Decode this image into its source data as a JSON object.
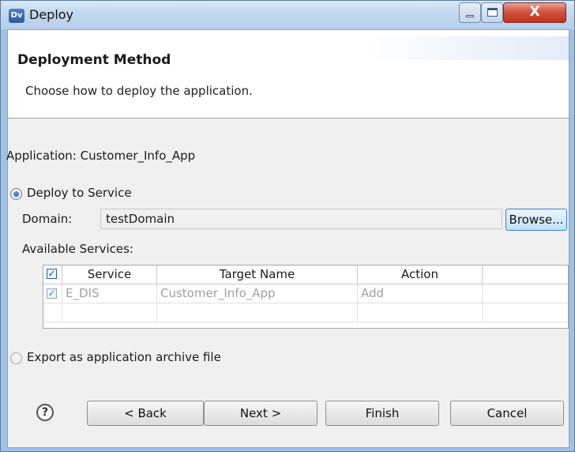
{
  "window": {
    "title": "Deploy",
    "icon_label": "Dv",
    "icon_name": "app-icon",
    "controls": {
      "minimize": "minimize-icon",
      "maximize": "maximize-icon",
      "close_glyph": "X"
    }
  },
  "banner": {
    "title": "Deployment Method",
    "description": "Choose how to deploy the application."
  },
  "application_label": "Application: Customer_Info_App",
  "deploy_to_service": {
    "label": "Deploy to Service",
    "selected": true,
    "domain_label": "Domain:",
    "domain_value": "testDomain",
    "browse_label": "Browse...",
    "services_label": "Available Services:",
    "table": {
      "headers": [
        "",
        "Service",
        "Target Name",
        "Action",
        ""
      ],
      "header_checked": true,
      "rows": [
        {
          "checked": true,
          "service": "E_DIS",
          "target_name": "Customer_Info_App",
          "action": "Add"
        }
      ]
    }
  },
  "export_archive": {
    "label": "Export as application archive file",
    "selected": false
  },
  "buttons": {
    "help_glyph": "?",
    "back": "< Back",
    "next": "Next >",
    "finish": "Finish",
    "cancel": "Cancel"
  },
  "colors": {
    "title_bar": "#c2d8ef",
    "close_button": "#c2321d",
    "dialog_background": "#f0f0f0",
    "browse_accent": "#3a7fd0"
  }
}
